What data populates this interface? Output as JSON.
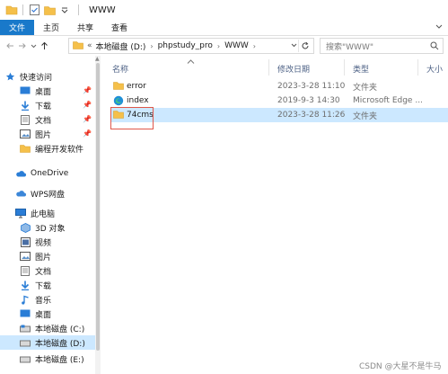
{
  "window": {
    "title": "WWW"
  },
  "ribbon": {
    "tabs": [
      "文件",
      "主页",
      "共享",
      "查看"
    ]
  },
  "address": {
    "prefix": "«",
    "segments": [
      "本地磁盘 (D:)",
      "phpstudy_pro",
      "WWW"
    ],
    "search_placeholder": "搜索\"WWW\""
  },
  "nav": {
    "quick_access": "快速访问",
    "quick_items": [
      "桌面",
      "下载",
      "文档",
      "图片",
      "编程开发软件"
    ],
    "onedrive": "OneDrive",
    "wps": "WPS网盘",
    "this_pc": "此电脑",
    "pc_items": [
      "3D 对象",
      "视频",
      "图片",
      "文档",
      "下载",
      "音乐",
      "桌面",
      "本地磁盘 (C:)",
      "本地磁盘 (D:)",
      "本地磁盘 (E:)"
    ]
  },
  "columns": {
    "name": "名称",
    "date": "修改日期",
    "type": "类型",
    "size": "大小"
  },
  "files": [
    {
      "name": "error",
      "date": "2023-3-28 11:10",
      "type": "文件夹",
      "icon": "folder-icon"
    },
    {
      "name": "index",
      "date": "2019-9-3 14:30",
      "type": "Microsoft Edge ...",
      "icon": "edge-icon"
    },
    {
      "name": "74cms",
      "date": "2023-3-28 11:26",
      "type": "文件夹",
      "icon": "folder-icon"
    }
  ],
  "watermark": "CSDN @大星不是牛马",
  "colors": {
    "accent": "#1979ca",
    "selection": "#cce8ff",
    "folder": "#f5c04a",
    "highlight": "#e0574a"
  }
}
